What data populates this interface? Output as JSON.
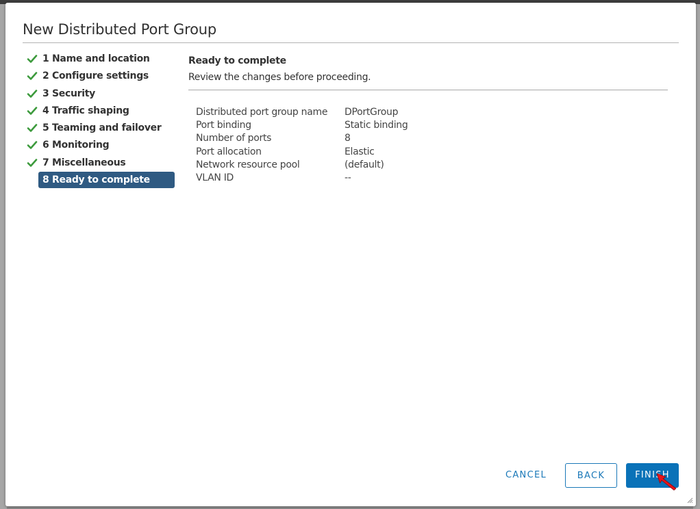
{
  "dialog": {
    "title": "New Distributed Port Group"
  },
  "steps": [
    {
      "label": "1 Name and location",
      "status": "complete"
    },
    {
      "label": "2 Configure settings",
      "status": "complete"
    },
    {
      "label": "3 Security",
      "status": "complete"
    },
    {
      "label": "4 Traffic shaping",
      "status": "complete"
    },
    {
      "label": "5 Teaming and failover",
      "status": "complete"
    },
    {
      "label": "6 Monitoring",
      "status": "complete"
    },
    {
      "label": "7 Miscellaneous",
      "status": "complete"
    },
    {
      "label": "8 Ready to complete",
      "status": "active"
    }
  ],
  "content": {
    "title": "Ready to complete",
    "description": "Review the changes before proceeding."
  },
  "summary": [
    {
      "key": "Distributed port group name",
      "value": "DPortGroup"
    },
    {
      "key": "Port binding",
      "value": "Static binding"
    },
    {
      "key": "Number of ports",
      "value": "8"
    },
    {
      "key": "Port allocation",
      "value": "Elastic"
    },
    {
      "key": "Network resource pool",
      "value": "(default)"
    },
    {
      "key": "VLAN ID",
      "value": "--"
    }
  ],
  "footer": {
    "cancel_label": "CANCEL",
    "back_label": "BACK",
    "finish_label": "FINISH"
  },
  "colors": {
    "check": "#3c9a3c",
    "active_step_bg": "#2f5a82",
    "primary_button": "#0a72b8",
    "link_blue": "#1a78b8"
  },
  "icons": {
    "step_complete": "check-icon",
    "cursor": "pointer-arrow-icon",
    "resize": "resize-grip-icon"
  }
}
